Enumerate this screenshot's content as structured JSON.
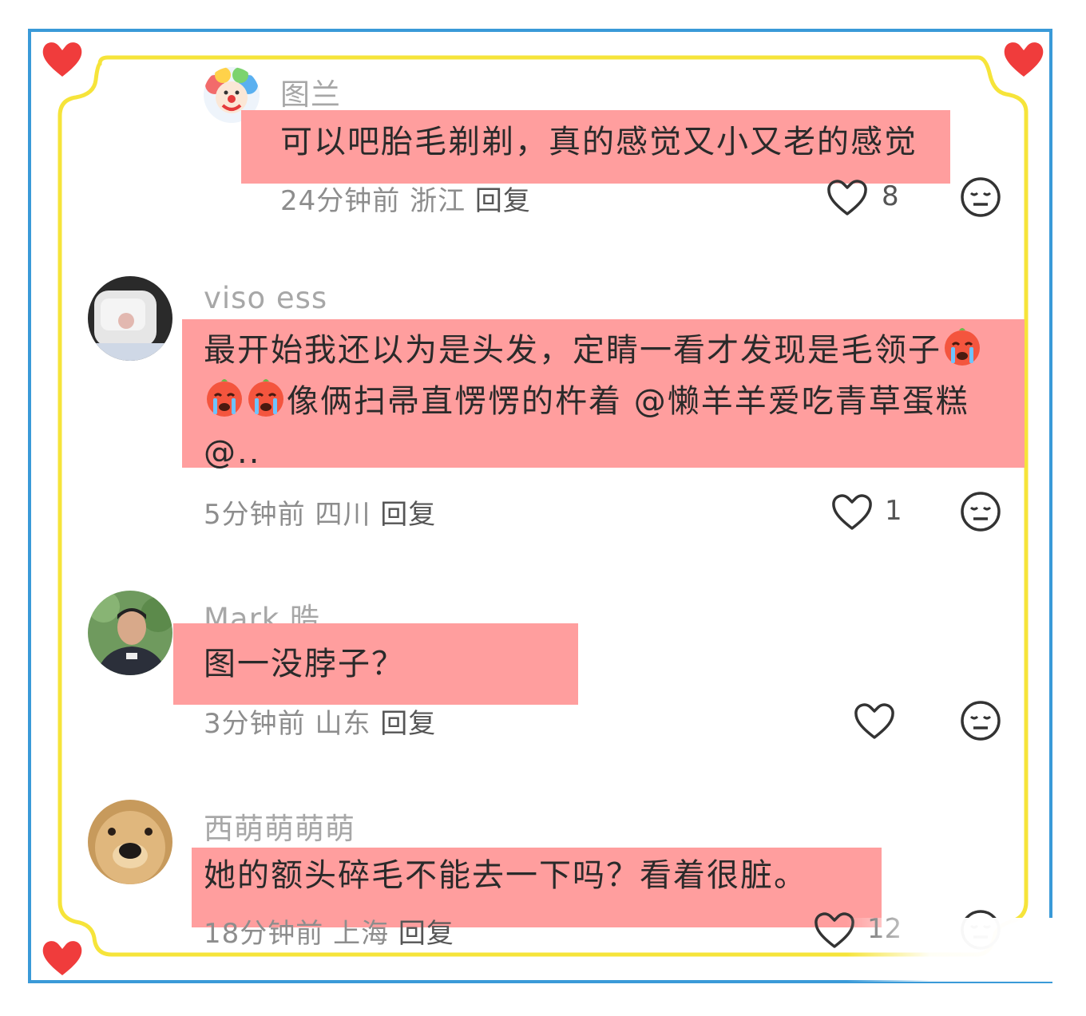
{
  "colors": {
    "frame_blue": "#3a9ad8",
    "frame_yellow": "#f6e43a",
    "heart_red": "#f03c3c",
    "highlight": "#ff9e9e"
  },
  "comments": [
    {
      "username": "图兰",
      "text_lines": [
        "可以吧胎毛剃剃，真的感觉又小又老的感觉"
      ],
      "time": "24分钟前",
      "location": "浙江",
      "reply": "回复",
      "likes": "8",
      "avatar": "clown-avatar"
    },
    {
      "username": "viso ess",
      "text_lines": [
        "最开始我还以为是头发，定睛一看才发现是毛领子",
        "像俩扫帚直愣愣的杵着 @懒羊羊爱吃青草蛋糕",
        "@.."
      ],
      "time": "5分钟前",
      "location": "四川",
      "reply": "回复",
      "likes": "1",
      "avatar": "car-seat-avatar"
    },
    {
      "username": "Mark 晧",
      "text_lines": [
        "图一没脖子？"
      ],
      "time": "3分钟前",
      "location": "山东",
      "reply": "回复",
      "likes": "",
      "avatar": "man-avatar"
    },
    {
      "username": "西萌萌萌萌",
      "text_lines": [
        "她的额头碎毛不能去一下吗？看着很脏。"
      ],
      "time": "18分钟前",
      "location": "上海",
      "reply": "回复",
      "likes": "12",
      "avatar": "dog-avatar"
    }
  ],
  "icons": {
    "like": "heart-outline-icon",
    "dislike": "neutral-face-icon",
    "emoji": "crying-face-emoji"
  }
}
